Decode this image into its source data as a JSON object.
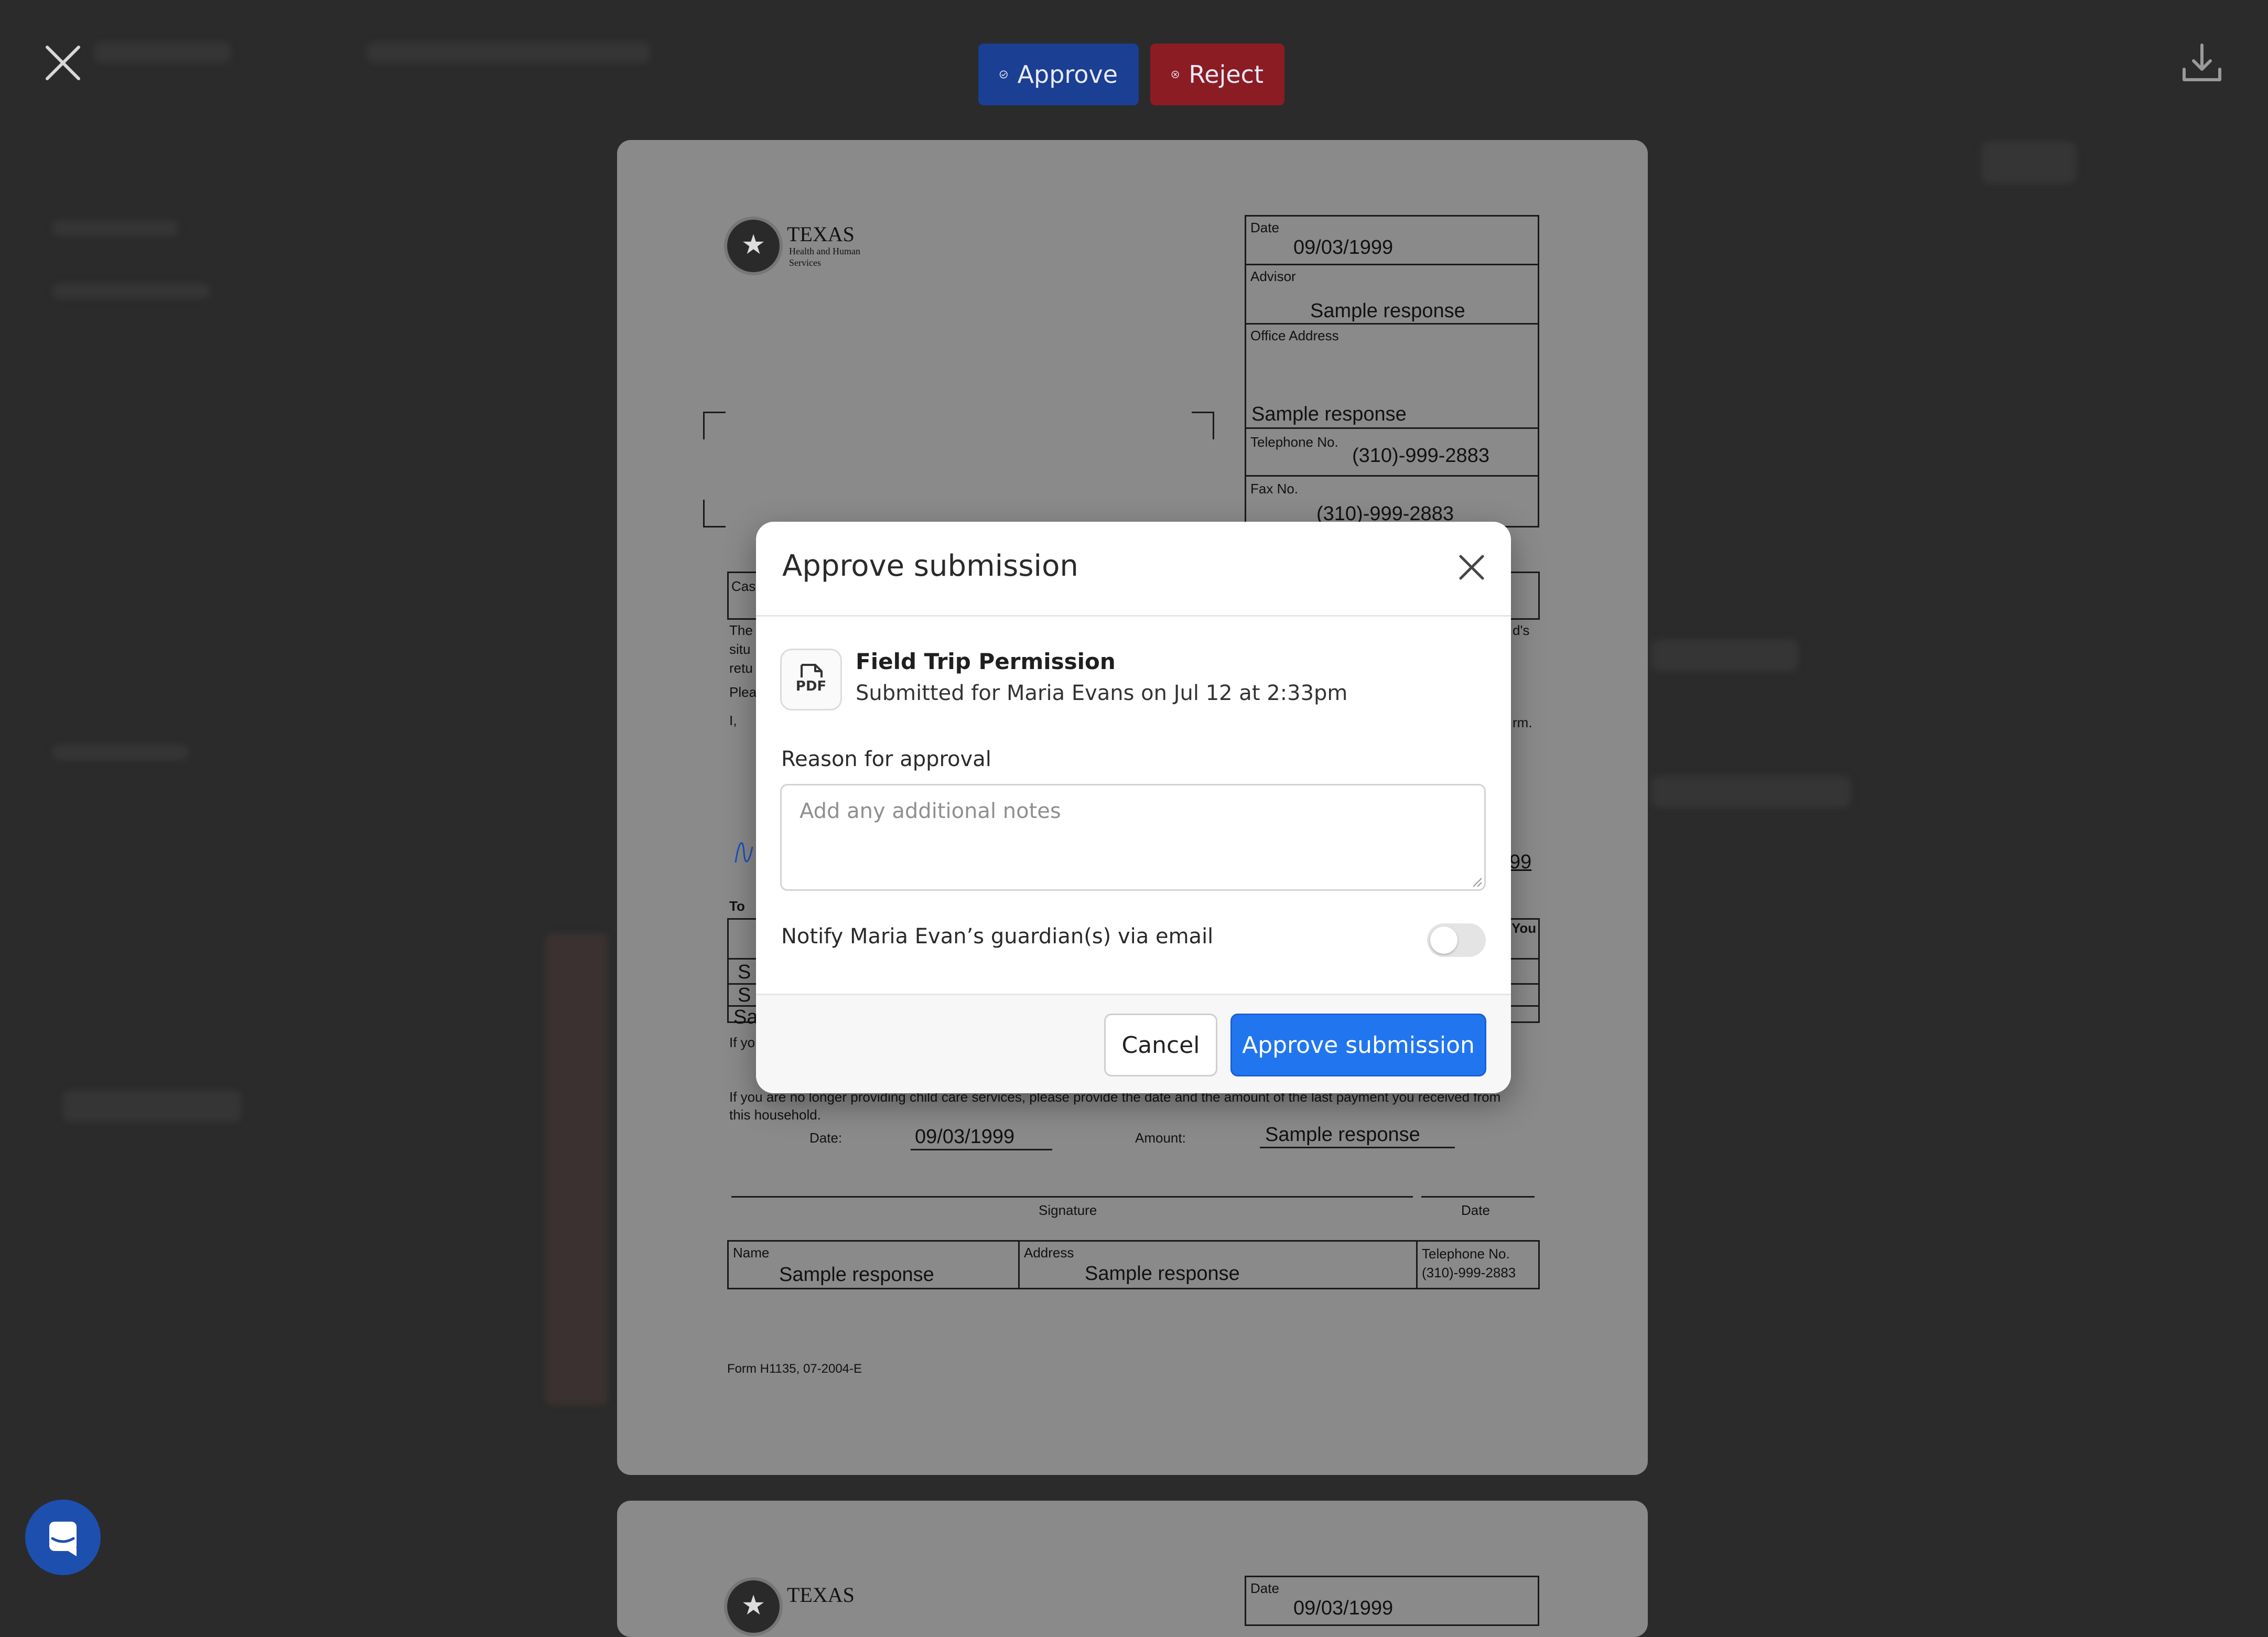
{
  "toolbar": {
    "approve_label": "Approve",
    "reject_label": "Reject",
    "approve_color": "#1a3f93",
    "reject_color": "#8c1c24",
    "icons": {
      "close": "close-icon",
      "download": "download-icon",
      "approve": "check-circle-icon",
      "reject": "x-circle-icon"
    }
  },
  "document": {
    "agency_name": "TEXAS",
    "agency_sub1": "Health and Human",
    "agency_sub2": "Services",
    "fields": {
      "date_label": "Date",
      "date_value": "09/03/1999",
      "advisor_label": "Advisor",
      "advisor_value": "Sample response",
      "office_label": "Office Address",
      "office_value": "Sample response",
      "phone_label": "Telephone No.",
      "phone_value": "(310)-999-2883",
      "fax_label": "Fax No.",
      "fax_value": "(310)-999-2883"
    },
    "fragments": {
      "cas": "Cas",
      "the": "The",
      "situ": "situ",
      "retu": "retu",
      "plea": "Plea",
      "i": "I,",
      "ds": "d's",
      "rm": "rm.",
      "n99": "99",
      "to": "To",
      "you": "You",
      "s1": "S",
      "s2": "S",
      "s3": "Sa",
      "ifyo": "If yo"
    },
    "bottom_note": "If you are no longer providing child care services, please provide the date and the amount of the last payment you received from this household.",
    "date_label2": "Date:",
    "date_value2": "09/03/1999",
    "amount_label": "Amount:",
    "amount_value": "Sample response",
    "signature_label": "Signature",
    "date_label3": "Date",
    "name_label": "Name",
    "name_value": "Sample response",
    "address_label": "Address",
    "address_value": "Sample response",
    "telephone_label": "Telephone No.",
    "telephone_value": "(310)-999-2883",
    "form_id": "Form H1135, 07-2004-E",
    "page2_date_label": "Date",
    "page2_date_value": "09/03/1999"
  },
  "modal": {
    "title": "Approve submission",
    "file_badge": "PDF",
    "file_name": "Field Trip Permission",
    "file_subtitle": "Submitted for Maria Evans on Jul 12 at 2:33pm",
    "reason_label": "Reason for approval",
    "notes_placeholder": "Add any additional notes",
    "notes_value": "",
    "notify_label": "Notify Maria Evan’s guardian(s) via email",
    "notify_enabled": false,
    "cancel_label": "Cancel",
    "approve_label": "Approve submission",
    "primary_color": "#2176f0"
  },
  "chat": {
    "icon": "chat-bubble-icon"
  }
}
